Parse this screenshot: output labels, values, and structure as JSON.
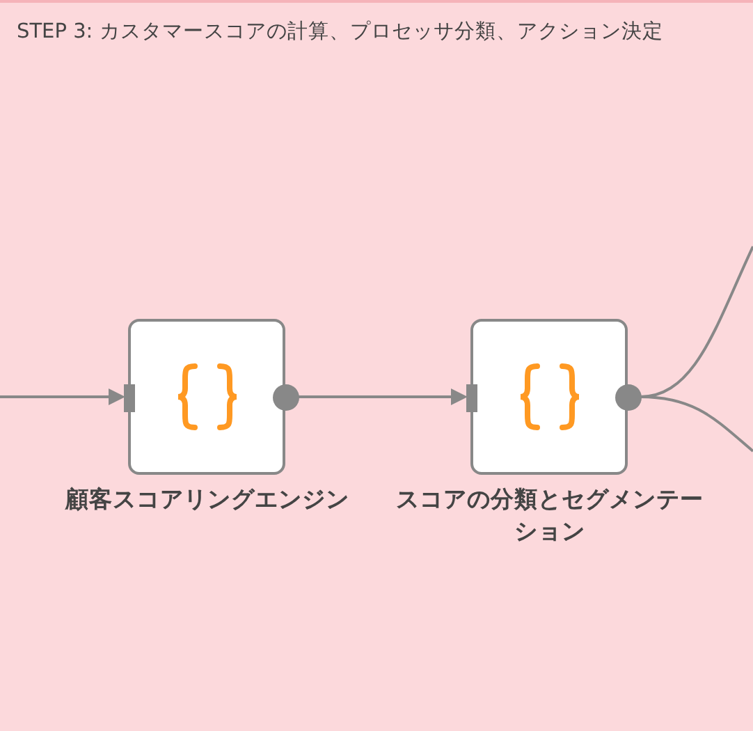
{
  "sticky_note": {
    "title": "STEP 3: カスタマースコアの計算、プロセッサ分類、アクション決定"
  },
  "nodes": [
    {
      "label": "顧客スコアリングエンジン",
      "kind": "code"
    },
    {
      "label": "スコアの分類とセグメンテーション",
      "kind": "code"
    }
  ]
}
